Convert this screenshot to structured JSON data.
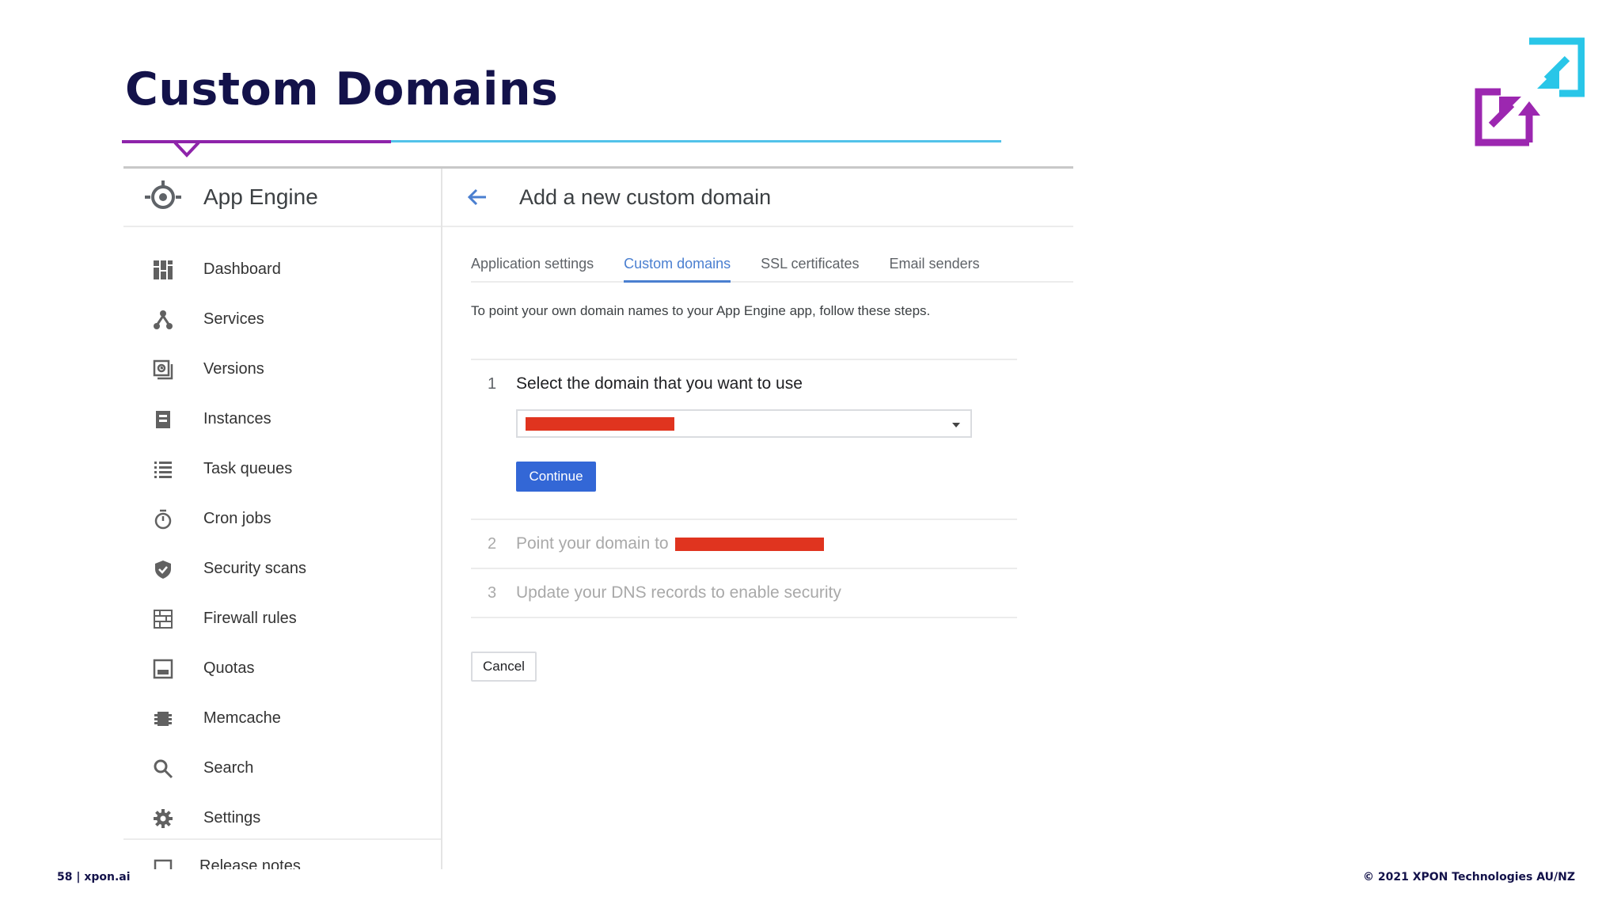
{
  "slide": {
    "title": "Custom Domains",
    "footer_left": "58 | xpon.ai",
    "footer_right": "© 2021 XPON Technologies AU/NZ",
    "colors": {
      "title": "#13124a",
      "accent_purple": "#8e24aa",
      "accent_blue": "#52c2ea"
    }
  },
  "app": {
    "title": "App Engine",
    "icon": "app-engine-icon"
  },
  "sidebar": {
    "items": [
      {
        "label": "Dashboard",
        "icon": "dashboard-icon"
      },
      {
        "label": "Services",
        "icon": "services-icon"
      },
      {
        "label": "Versions",
        "icon": "versions-icon"
      },
      {
        "label": "Instances",
        "icon": "instances-icon"
      },
      {
        "label": "Task queues",
        "icon": "task-queues-icon"
      },
      {
        "label": "Cron jobs",
        "icon": "cron-jobs-icon"
      },
      {
        "label": "Security scans",
        "icon": "security-scans-icon"
      },
      {
        "label": "Firewall rules",
        "icon": "firewall-icon"
      },
      {
        "label": "Quotas",
        "icon": "quotas-icon"
      },
      {
        "label": "Memcache",
        "icon": "memcache-icon"
      },
      {
        "label": "Search",
        "icon": "search-icon"
      },
      {
        "label": "Settings",
        "icon": "settings-icon"
      }
    ],
    "clipped_item": {
      "label": "Release notes",
      "icon": "release-notes-icon"
    }
  },
  "main": {
    "title": "Add a new custom domain",
    "tabs": [
      {
        "label": "Application settings",
        "active": false
      },
      {
        "label": "Custom domains",
        "active": true
      },
      {
        "label": "SSL certificates",
        "active": false
      },
      {
        "label": "Email senders",
        "active": false
      }
    ],
    "intro": "To point your own domain names to your App Engine app, follow these steps.",
    "steps": [
      {
        "num": "1",
        "text": "Select the domain that you want to use"
      },
      {
        "num": "2",
        "text": "Point your domain to"
      },
      {
        "num": "3",
        "text": "Update your DNS records to enable security"
      }
    ],
    "continue_label": "Continue",
    "cancel_label": "Cancel",
    "colors": {
      "primary": "#3367d6",
      "tab_active": "#4a7fd0",
      "redaction": "#e0341f"
    }
  }
}
